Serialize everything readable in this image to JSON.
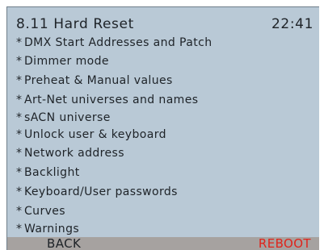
{
  "header": {
    "title": "8.11 Hard Reset",
    "clock": "22:41"
  },
  "items": [
    {
      "bullet": "*",
      "label": "DMX Start Addresses and Patch"
    },
    {
      "bullet": "*",
      "label": "Dimmer mode"
    },
    {
      "bullet": "*",
      "label": "Preheat & Manual values"
    },
    {
      "bullet": "*",
      "label": "Art-Net universes and names"
    },
    {
      "bullet": "*",
      "label": "sACN universe"
    },
    {
      "bullet": "*",
      "label": "Unlock user & keyboard"
    },
    {
      "bullet": "*",
      "label": "Network address"
    },
    {
      "bullet": "*",
      "label": "Backlight"
    },
    {
      "bullet": "*",
      "label": "Keyboard/User passwords"
    },
    {
      "bullet": "*",
      "label": "Curves"
    },
    {
      "bullet": "*",
      "label": "Warnings"
    }
  ],
  "softkeys": {
    "left_label": "BACK",
    "right_label": "REBOOT"
  },
  "colors": {
    "screen_background": "#b9c9d6",
    "text": "#1e2328",
    "softkey_bar": "#a6a2a0",
    "reboot": "#e0241b"
  }
}
